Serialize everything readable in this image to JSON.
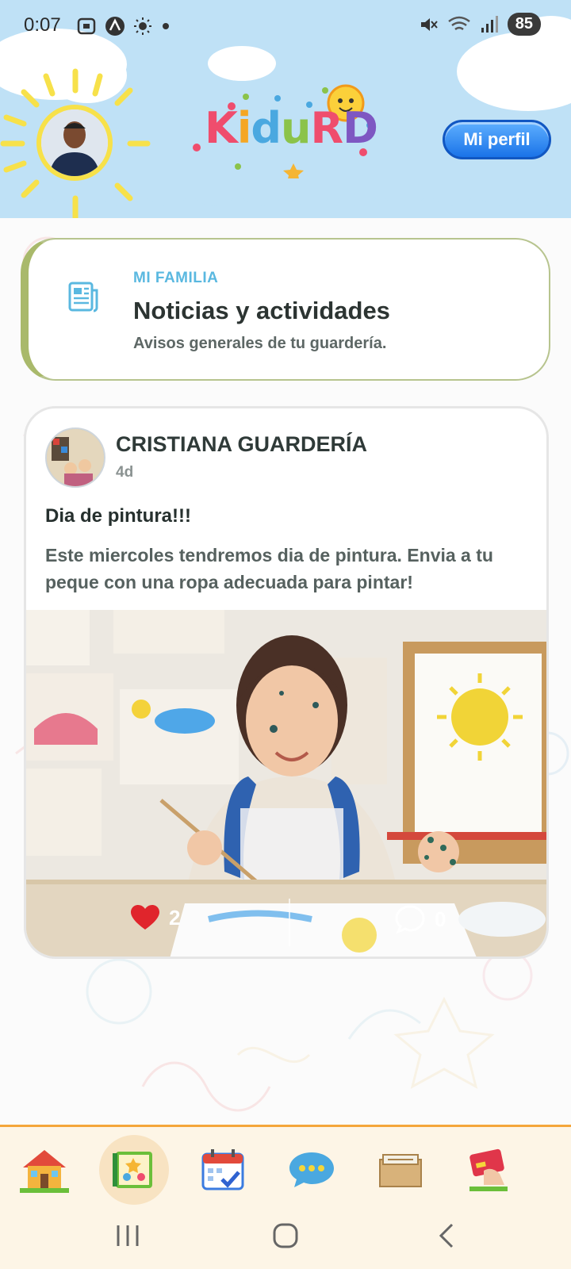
{
  "status_bar": {
    "time": "0:07",
    "battery": "85"
  },
  "header": {
    "logo_text": "KiduRD",
    "profile_button": "Mi perfil"
  },
  "section": {
    "eyebrow": "MI FAMILIA",
    "title": "Noticias y actividades",
    "subtitle": "Avisos generales de tu guardería."
  },
  "post": {
    "author": "CRISTIANA GUARDERÍA",
    "age": "4d",
    "title": "Dia de pintura!!!",
    "body": "Este miercoles tendremos dia de pintura. Envia a tu peque con una ropa adecuada para pintar!",
    "likes": "2",
    "comments": "0"
  },
  "bottom_nav": {
    "items": [
      {
        "icon": "house-icon",
        "active": false
      },
      {
        "icon": "news-book-icon",
        "active": true
      },
      {
        "icon": "calendar-check-icon",
        "active": false
      },
      {
        "icon": "chat-bubble-icon",
        "active": false
      },
      {
        "icon": "box-icon",
        "active": false
      },
      {
        "icon": "payment-card-icon",
        "active": false
      }
    ]
  },
  "colors": {
    "header_sky": "#bfe1f6",
    "accent_green": "#a9b96b",
    "eyebrow_blue": "#5ab8e0",
    "profile_blue": "#1a73e8",
    "nav_border": "#f4a63a",
    "like_red": "#e0252c"
  }
}
